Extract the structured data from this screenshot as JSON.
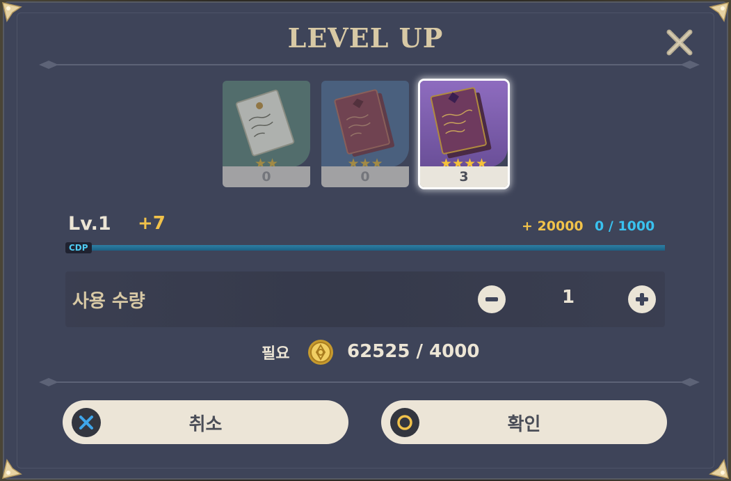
{
  "dialog": {
    "title": "LEVEL UP",
    "close_icon": "close-x-icon"
  },
  "materials": [
    {
      "name": "2-star book",
      "stars": "★★",
      "count": "0",
      "state": "disabled",
      "color": "#5a7d74"
    },
    {
      "name": "3-star book",
      "stars": "★★★",
      "count": "0",
      "state": "disabled",
      "color": "#4f6a8c"
    },
    {
      "name": "4-star book",
      "stars": "★★★★",
      "count": "3",
      "state": "selected",
      "color": "#7b5fa8"
    }
  ],
  "level": {
    "current": "Lv.1",
    "increase": "+7",
    "exp_add": "+ 20000",
    "exp_progress": "0 / 1000",
    "bar_label": "CDP",
    "bar_fill": 0
  },
  "quantity": {
    "label": "사용 수량",
    "value": "1",
    "minus_icon": "minus-icon",
    "plus_icon": "plus-icon"
  },
  "cost": {
    "label": "필요",
    "coin_icon": "mora-coin-icon",
    "value": "62525 / 4000"
  },
  "buttons": {
    "cancel": "취소",
    "confirm": "확인"
  },
  "colors": {
    "panel": "#3e4459",
    "gold_text": "#d8c9a5",
    "yellow": "#f1c24a",
    "cyan": "#39c2f0",
    "button": "#ece5d7"
  }
}
